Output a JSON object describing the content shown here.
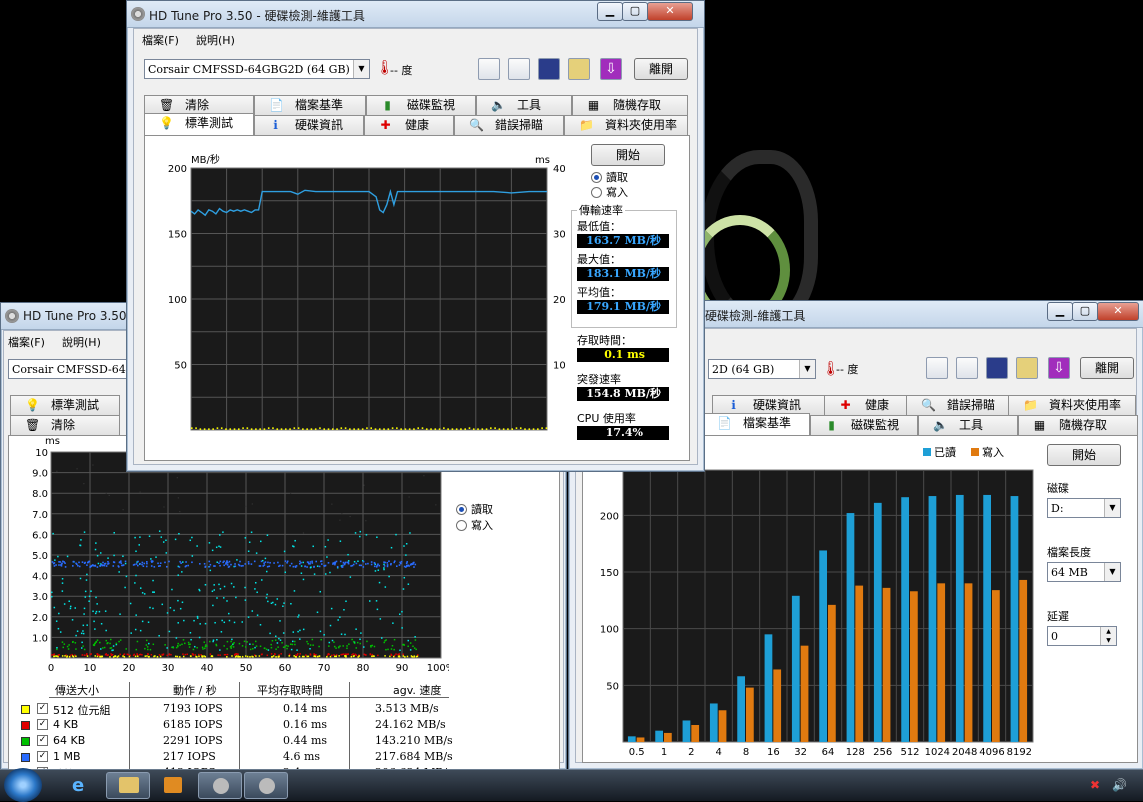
{
  "front": {
    "title": "HD Tune Pro 3.50 - 硬碟檢測-維護工具",
    "menu": [
      "檔案(F)",
      "說明(H)"
    ],
    "drive": "Corsair CMFSSD-64GBG2D (64 GB)",
    "temp": "-- 度",
    "exit": "離開",
    "tabs_top": [
      "清除",
      "檔案基準",
      "磁碟監視",
      "工具",
      "隨機存取"
    ],
    "tabs_bottom": [
      "標準測試",
      "硬碟資訊",
      "健康",
      "錯誤掃瞄",
      "資料夾使用率"
    ],
    "start": "開始",
    "read": "讀取",
    "write": "寫入",
    "rate_group": "傳輸速率",
    "min_label": "最低值：",
    "min": "163.7 MB/秒",
    "max_label": "最大值：",
    "max": "183.1 MB/秒",
    "avg_label": "平均值：",
    "avg": "179.1 MB/秒",
    "access_label": "存取時間：",
    "access": "0.1 ms",
    "burst_label": "突發速率",
    "burst": "154.8 MB/秒",
    "cpu_label": "CPU 使用率",
    "cpu": "17.4%"
  },
  "left": {
    "title": "HD Tune Pro 3.50 -",
    "menu": [
      "檔案(F)",
      "說明(H)"
    ],
    "drive": "Corsair CMFSSD-64GB",
    "tabs": [
      "標準測試",
      "清除"
    ],
    "read": "讀取",
    "write": "寫入",
    "table_headers": [
      "傳送大小",
      "動作 / 秒",
      "平均存取時間",
      "agv. 速度"
    ],
    "rows": [
      {
        "size": "512 位元組",
        "iops": "7193 IOPS",
        "time": "0.14 ms",
        "speed": "3.513 MB/s",
        "color": "#ffff00"
      },
      {
        "size": "4 KB",
        "iops": "6185 IOPS",
        "time": "0.16 ms",
        "speed": "24.162 MB/s",
        "color": "#e00000"
      },
      {
        "size": "64 KB",
        "iops": "2291 IOPS",
        "time": "0.44 ms",
        "speed": "143.210 MB/s",
        "color": "#00c000"
      },
      {
        "size": "1 MB",
        "iops": "217 IOPS",
        "time": "4.6 ms",
        "speed": "217.684 MB/s",
        "color": "#2a6cff"
      },
      {
        "size": "隨機",
        "iops": "413 IOPS",
        "time": "2.4 ms",
        "speed": "206.634 MB/s",
        "color": "#00e8e8"
      }
    ]
  },
  "right": {
    "title": "硬碟檢測-維護工具",
    "drive": "2D (64 GB)",
    "temp": "-- 度",
    "exit": "離開",
    "tabs_top": [
      "硬碟資訊",
      "健康",
      "錯誤掃瞄",
      "資料夾使用率"
    ],
    "tabs_bottom": [
      "檔案基準",
      "磁碟監視",
      "工具",
      "隨機存取"
    ],
    "start": "開始",
    "disk_label": "磁碟",
    "disk": "D:",
    "filelen_label": "檔案長度",
    "filelen": "64 MB",
    "delay_label": "延遲",
    "delay": "0"
  },
  "chart_data": [
    {
      "type": "line",
      "chart": "transfer-rate",
      "xlabel": "",
      "ylabel": "MB/秒",
      "y2label": "ms",
      "ylim": [
        0,
        200
      ],
      "y2lim": [
        0,
        40
      ],
      "yticks": [
        200,
        150,
        100,
        50
      ],
      "y2ticks": [
        40,
        30,
        20,
        10
      ],
      "xticks": [
        "0",
        "10",
        "20",
        "30",
        "40",
        "50",
        "60",
        "70",
        "80",
        "90",
        "100%"
      ],
      "series": [
        {
          "name": "讀取",
          "color": "#2f9fe0",
          "x": [
            0,
            1,
            2,
            3,
            4,
            5,
            6,
            7,
            8,
            9,
            10,
            11,
            12,
            13,
            14,
            15,
            16,
            17,
            18,
            19,
            20,
            22,
            25,
            28,
            30,
            32,
            35,
            38,
            40,
            45,
            50,
            52,
            53,
            54,
            55,
            56,
            57,
            58,
            60,
            62,
            65,
            70,
            75,
            80,
            85,
            90,
            95,
            100
          ],
          "y": [
            167,
            165,
            168,
            166,
            164,
            168,
            167,
            165,
            169,
            167,
            166,
            168,
            167,
            168,
            167,
            168,
            167,
            166,
            168,
            168,
            182,
            182,
            182,
            182,
            180,
            183,
            182,
            182,
            182,
            182,
            182,
            178,
            168,
            166,
            172,
            182,
            172,
            182,
            182,
            182,
            182,
            182,
            182,
            182,
            182,
            181,
            182,
            182
          ]
        },
        {
          "name": "存取時間",
          "color": "#ffff00",
          "unit": "ms",
          "value": 0.1
        }
      ]
    },
    {
      "type": "scatter",
      "chart": "random-access",
      "ylabel": "ms",
      "ylim": [
        0,
        10
      ],
      "yticks": [
        "10",
        "9.0",
        "8.0",
        "7.0",
        "6.0",
        "5.0",
        "4.0",
        "3.0",
        "2.0",
        "1.0"
      ],
      "xticks": [
        "0",
        "10",
        "20",
        "30",
        "40",
        "50",
        "60",
        "70",
        "80",
        "90",
        "100%"
      ],
      "bands": [
        {
          "series": "1 MB",
          "center_ms": 4.6,
          "color": "#2a6cff"
        },
        {
          "series": "64 KB",
          "center_ms": 0.44,
          "color": "#00c000"
        },
        {
          "series": "4 KB",
          "center_ms": 0.16,
          "color": "#e00000"
        },
        {
          "series": "512 位元組",
          "center_ms": 0.14,
          "color": "#ffff00"
        },
        {
          "series": "隨機",
          "center_ms": 2.4,
          "color": "#00e8e8"
        }
      ]
    },
    {
      "type": "bar",
      "chart": "file-benchmark",
      "categories": [
        "0.5",
        "1",
        "2",
        "4",
        "8",
        "16",
        "32",
        "64",
        "128",
        "256",
        "512",
        "1024",
        "2048",
        "4096",
        "8192"
      ],
      "yticks": [
        200,
        150,
        100,
        50
      ],
      "ylim": [
        0,
        240
      ],
      "legend": "top-right",
      "series": [
        {
          "name": "已讀",
          "color": "#1e9fd6",
          "values": [
            5,
            10,
            19,
            34,
            58,
            95,
            129,
            169,
            202,
            211,
            216,
            217,
            218,
            218,
            217
          ]
        },
        {
          "name": "寫入",
          "color": "#e07a10",
          "values": [
            4,
            8,
            15,
            28,
            48,
            64,
            85,
            121,
            138,
            136,
            133,
            140,
            140,
            134,
            143
          ]
        }
      ]
    }
  ]
}
